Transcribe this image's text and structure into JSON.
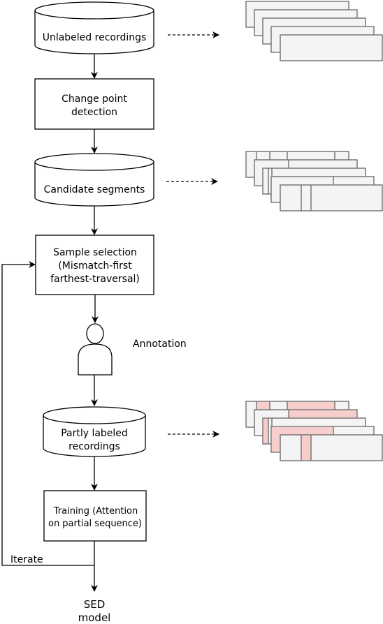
{
  "nodes": {
    "unlabeled": "Unlabeled recordings",
    "change_point": [
      "Change point",
      "detection"
    ],
    "candidate": "Candidate segments",
    "sample_selection": [
      "Sample selection",
      "(Mismatch-first",
      "farthest-traversal)"
    ],
    "annotation": "Annotation",
    "partly_labeled": [
      "Partly labeled",
      "recordings"
    ],
    "training": [
      "Training (Attention",
      "on partial sequence)"
    ],
    "output": [
      "SED",
      "model"
    ],
    "iterate": "Iterate"
  },
  "colors": {
    "segment_fill": "#f4f4f4",
    "segment_stroke": "#707070",
    "labeled_segment": "#f8cecc"
  },
  "icons": [
    "database-cylinder",
    "person-icon"
  ]
}
